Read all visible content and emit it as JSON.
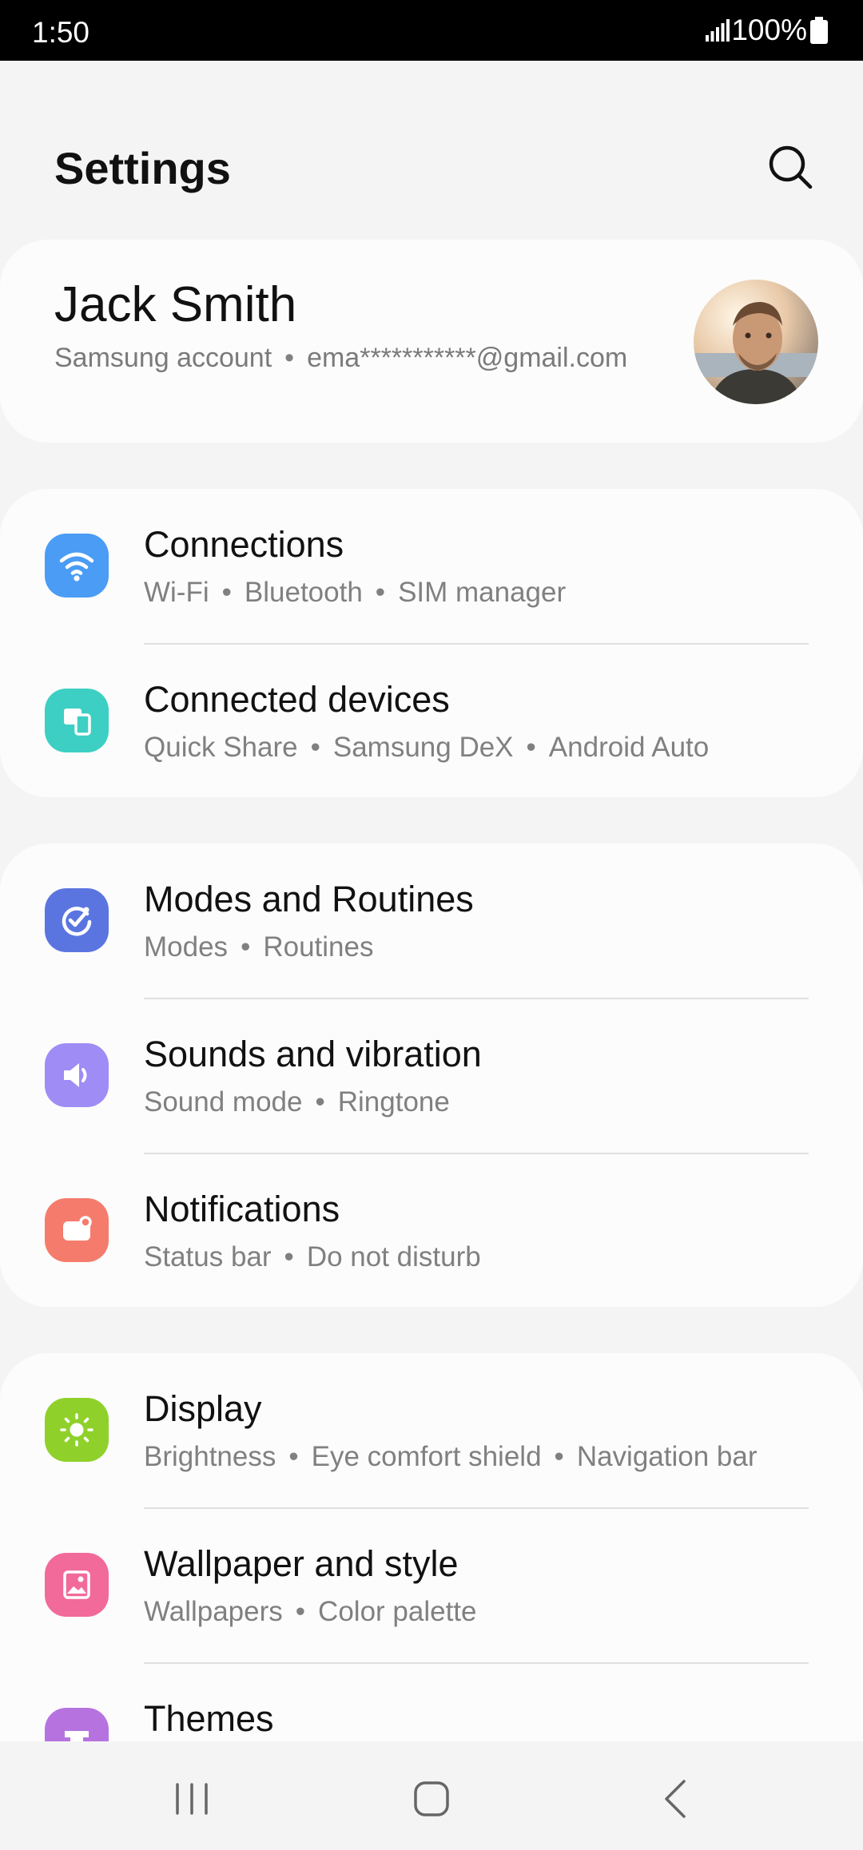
{
  "status_bar": {
    "time": "1:50",
    "battery": "100%"
  },
  "header": {
    "title": "Settings"
  },
  "account": {
    "name": "Jack Smith",
    "label": "Samsung account",
    "email": "ema***********@gmail.com"
  },
  "groups": [
    [
      {
        "title": "Connections",
        "subs": [
          "Wi-Fi",
          "Bluetooth",
          "SIM manager"
        ],
        "icon": "wifi-icon",
        "color": "#4a9cf5"
      },
      {
        "title": "Connected devices",
        "subs": [
          "Quick Share",
          "Samsung DeX",
          "Android Auto"
        ],
        "icon": "devices-icon",
        "color": "#3dcfc3"
      }
    ],
    [
      {
        "title": "Modes and Routines",
        "subs": [
          "Modes",
          "Routines"
        ],
        "icon": "routines-icon",
        "color": "#5b75e0"
      },
      {
        "title": "Sounds and vibration",
        "subs": [
          "Sound mode",
          "Ringtone"
        ],
        "icon": "speaker-icon",
        "color": "#a08cf5"
      },
      {
        "title": "Notifications",
        "subs": [
          "Status bar",
          "Do not disturb"
        ],
        "icon": "notification-icon",
        "color": "#f57c6c"
      }
    ],
    [
      {
        "title": "Display",
        "subs": [
          "Brightness",
          "Eye comfort shield",
          "Navigation bar"
        ],
        "icon": "sun-icon",
        "color": "#8fd12a"
      },
      {
        "title": "Wallpaper and style",
        "subs": [
          "Wallpapers",
          "Color palette"
        ],
        "icon": "wallpaper-icon",
        "color": "#f26a9a"
      },
      {
        "title": "Themes",
        "subs": [],
        "icon": "themes-icon",
        "color": "#b673e0"
      }
    ]
  ]
}
